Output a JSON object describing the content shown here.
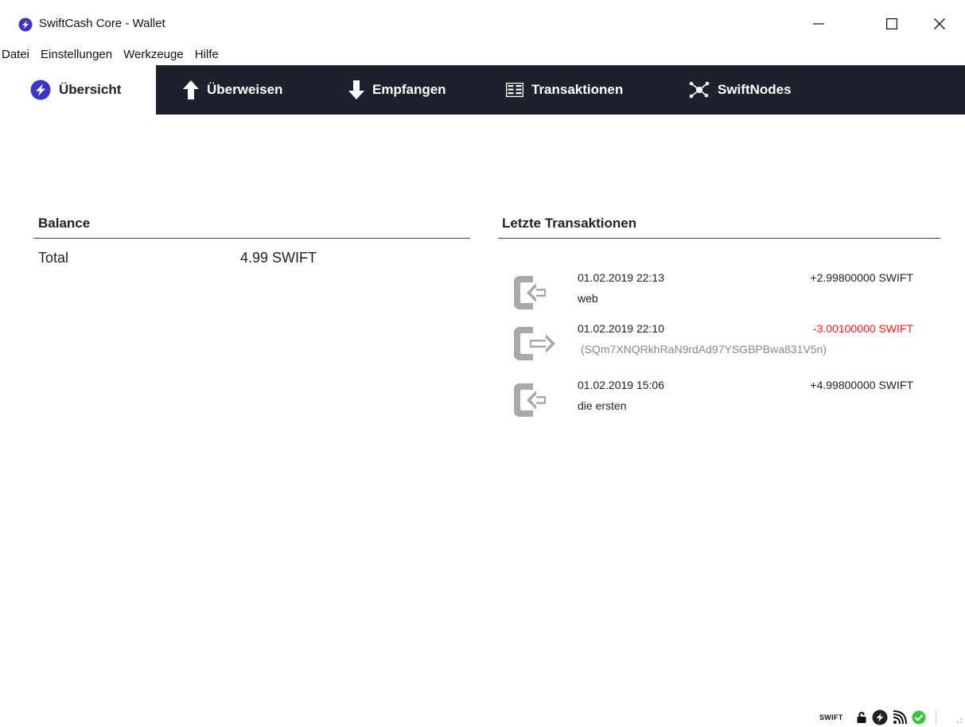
{
  "window": {
    "title": "SwiftCash Core - Wallet",
    "minimize": "—",
    "maximize": "☐",
    "close": "✕"
  },
  "menu": [
    "Datei",
    "Einstellungen",
    "Werkzeuge",
    "Hilfe"
  ],
  "tabs": {
    "overview": "Übersicht",
    "send": "Überweisen",
    "receive": "Empfangen",
    "transactions": "Transaktionen",
    "nodes": "SwiftNodes"
  },
  "balance": {
    "title": "Balance",
    "total_label": "Total",
    "total_value": "4.99 SWIFT"
  },
  "recent": {
    "title": "Letzte Transaktionen",
    "items": [
      {
        "date": "01.02.2019 22:13",
        "label": "web",
        "amount": "+2.99800000 SWIFT",
        "direction": "incoming"
      },
      {
        "date": "01.02.2019 22:10",
        "label": "(SQm7XNQRkhRaN9rdAd97YSGBPBwa831V5n)",
        "amount": "-3.00100000 SWIFT",
        "direction": "outgoing"
      },
      {
        "date": "01.02.2019 15:06",
        "label": "die ersten",
        "amount": "+4.99800000 SWIFT",
        "direction": "incoming"
      }
    ]
  },
  "status": {
    "unit": "SWIFT",
    "icons": [
      "lock-icon",
      "swift-logo-icon",
      "network-icon",
      "synced-check-icon"
    ]
  },
  "colors": {
    "toolbar": "#1e212b",
    "brand": "#3b34c9",
    "negative": "#ff1a1a",
    "tx_icon": "#a9a9a9",
    "synced": "#3cc43c"
  }
}
